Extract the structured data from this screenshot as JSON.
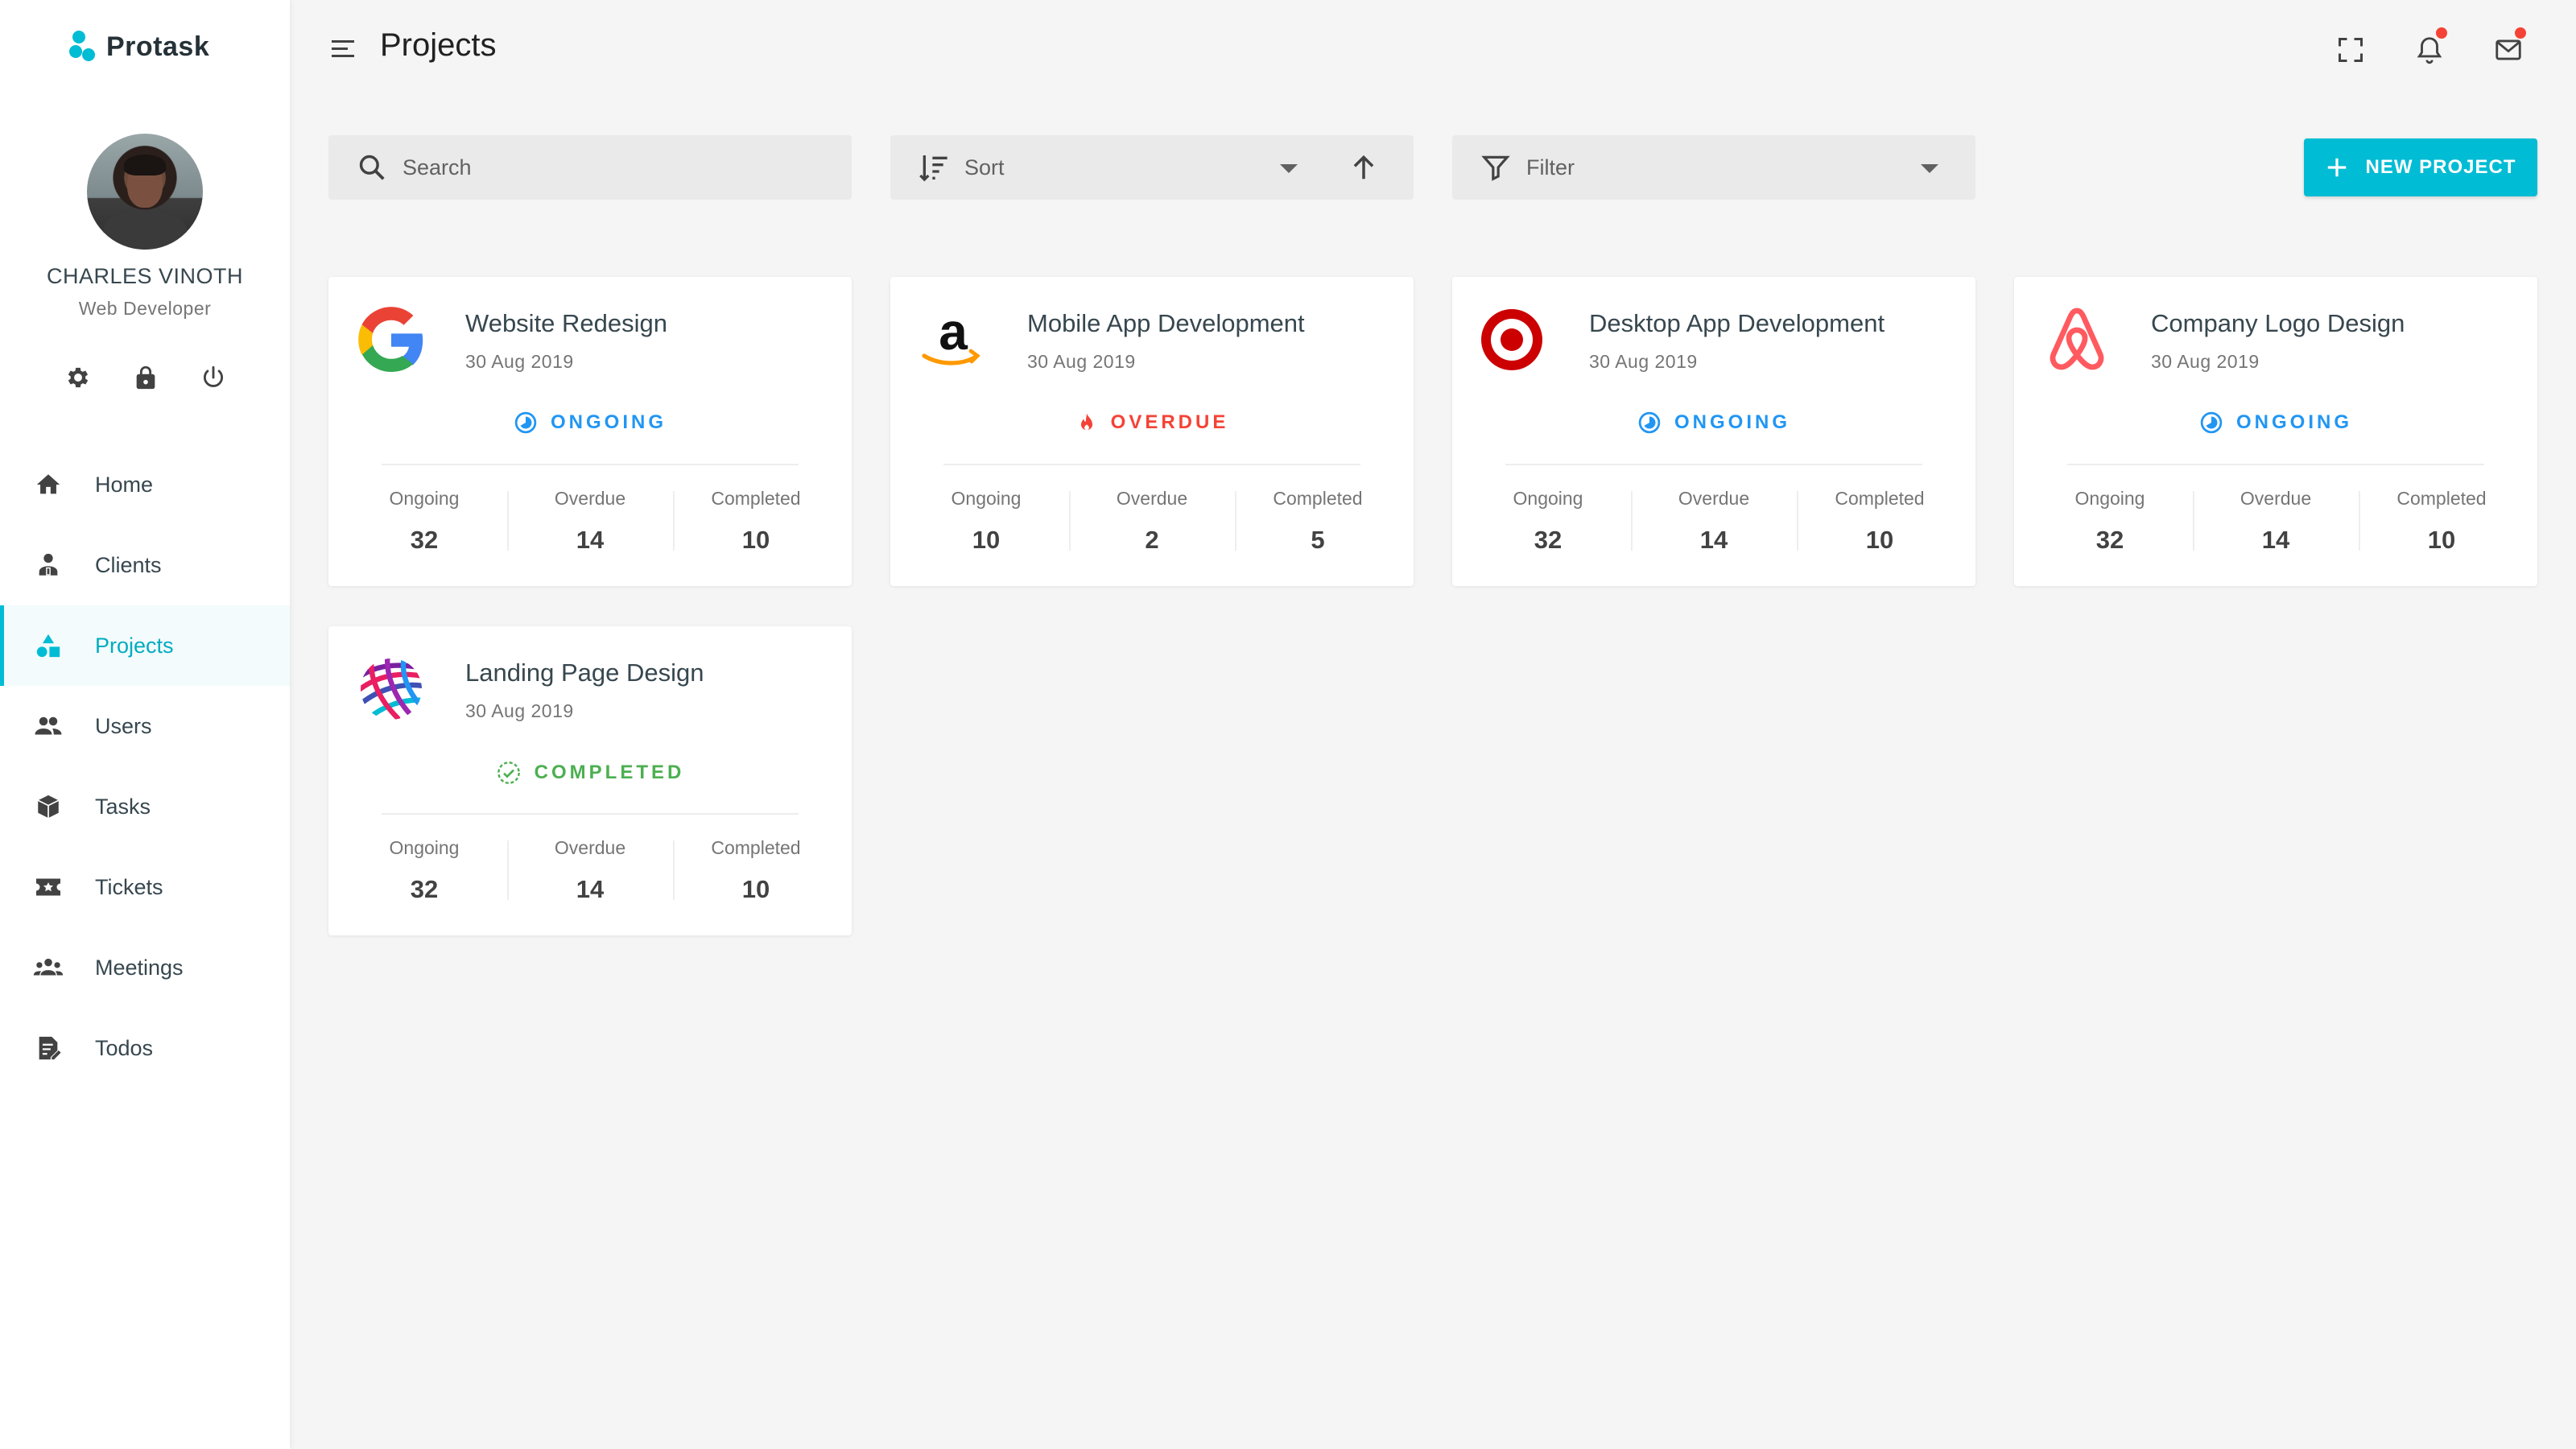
{
  "brand": {
    "name": "Protask",
    "accent": "#00bcd4"
  },
  "user": {
    "name": "CHARLES VINOTH",
    "role": "Web Developer"
  },
  "user_actions": [
    "gear-icon",
    "lock-icon",
    "power-icon"
  ],
  "nav": {
    "items": [
      {
        "label": "Home",
        "icon": "home-icon",
        "active": false
      },
      {
        "label": "Clients",
        "icon": "client-icon",
        "active": false
      },
      {
        "label": "Projects",
        "icon": "shapes-icon",
        "active": true
      },
      {
        "label": "Users",
        "icon": "users-icon",
        "active": false
      },
      {
        "label": "Tasks",
        "icon": "cube-icon",
        "active": false
      },
      {
        "label": "Tickets",
        "icon": "ticket-icon",
        "active": false
      },
      {
        "label": "Meetings",
        "icon": "meeting-icon",
        "active": false
      },
      {
        "label": "Todos",
        "icon": "todo-icon",
        "active": false
      }
    ]
  },
  "header": {
    "title": "Projects"
  },
  "toolbar": {
    "search_placeholder": "Search",
    "sort_label": "Sort",
    "filter_label": "Filter",
    "new_project_label": "NEW PROJECT"
  },
  "status_colors": {
    "ongoing": "#2196f3",
    "overdue": "#f44336",
    "completed": "#4caf50"
  },
  "stat_labels": {
    "ongoing": "Ongoing",
    "overdue": "Overdue",
    "completed": "Completed"
  },
  "projects": [
    {
      "title": "Website Redesign",
      "date": "30 Aug 2019",
      "status": "ONGOING",
      "logo": "google-logo",
      "stats": {
        "ongoing": "32",
        "overdue": "14",
        "completed": "10"
      }
    },
    {
      "title": "Mobile App Development",
      "date": "30 Aug 2019",
      "status": "OVERDUE",
      "logo": "amazon-logo",
      "stats": {
        "ongoing": "10",
        "overdue": "2",
        "completed": "5"
      }
    },
    {
      "title": "Desktop App Development",
      "date": "30 Aug 2019",
      "status": "ONGOING",
      "logo": "target-logo",
      "stats": {
        "ongoing": "32",
        "overdue": "14",
        "completed": "10"
      }
    },
    {
      "title": "Company Logo Design",
      "date": "30 Aug 2019",
      "status": "ONGOING",
      "logo": "airbnb-logo",
      "stats": {
        "ongoing": "32",
        "overdue": "14",
        "completed": "10"
      }
    },
    {
      "title": "Landing Page Design",
      "date": "30 Aug 2019",
      "status": "COMPLETED",
      "logo": "globe-logo",
      "stats": {
        "ongoing": "32",
        "overdue": "14",
        "completed": "10"
      }
    }
  ]
}
